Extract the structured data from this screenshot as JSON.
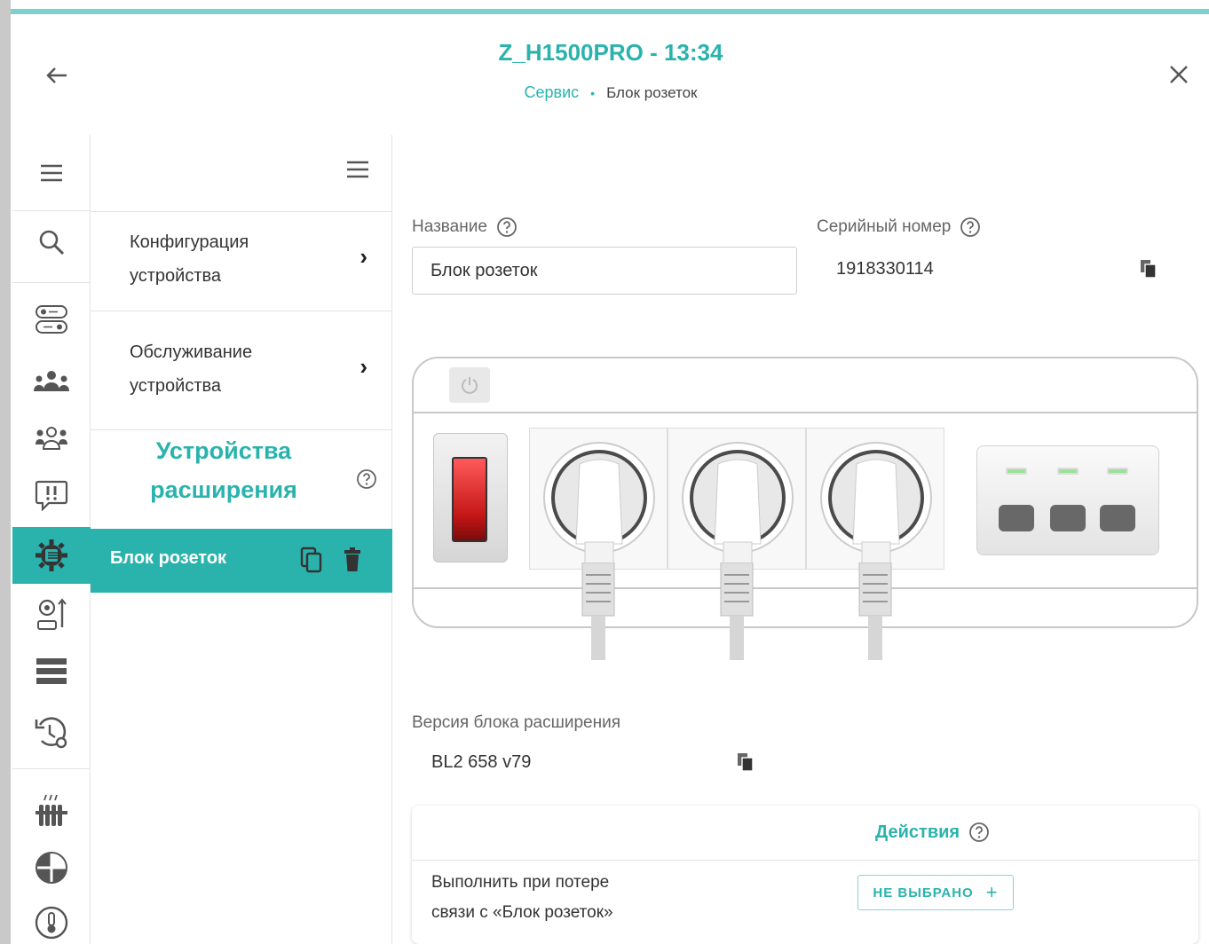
{
  "header": {
    "title": "Z_H1500PRO - 13:34",
    "breadcrumb": {
      "section": "Сервис",
      "separator": "•",
      "current": "Блок розеток"
    }
  },
  "rail": {
    "icons": [
      "menu-icon",
      "search-icon",
      "io-toggle-icon",
      "users-group-icon",
      "users-outline-icon",
      "alert-bubble-icon",
      "gear-chip-icon",
      "settings-tools-icon",
      "list-icon",
      "history-gear-icon",
      "radiator-icon",
      "heating-circuit-icon",
      "thermometer-icon"
    ],
    "active": "gear-chip-icon"
  },
  "submenu": {
    "items": [
      {
        "line1": "Конфигурация",
        "line2": "устройства",
        "chevron": "›"
      },
      {
        "line1": "Обслуживание",
        "line2": "устройства",
        "chevron": "›"
      }
    ],
    "section_title_line1": "Устройства",
    "section_title_line2": "расширения",
    "active_item": "Блок розеток"
  },
  "form": {
    "name_label": "Название",
    "name_value": "Блок розеток",
    "serial_label": "Серийный номер",
    "serial_value": "1918330114",
    "version_label": "Версия блока расширения",
    "version_value": "BL2 658 v79"
  },
  "actions": {
    "title": "Действия",
    "row_label_line1": "Выполнить при потере",
    "row_label_line2": "связи с «Блок розеток»",
    "button_label": "НЕ ВЫБРАНО",
    "button_icon": "+"
  },
  "colors": {
    "accent": "#2ab3ad",
    "switch_red": "#d32020",
    "led_green": "#9be09b"
  }
}
